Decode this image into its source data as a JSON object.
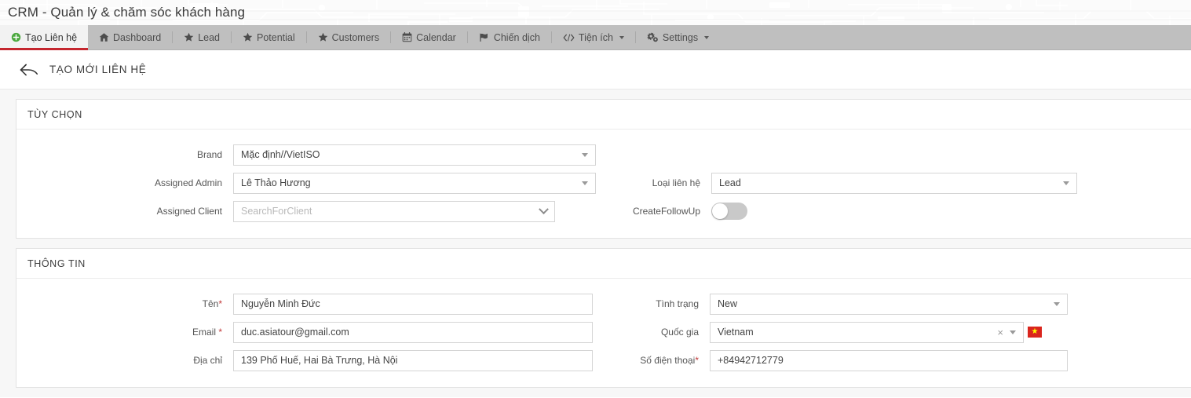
{
  "window": {
    "title": "CRM - Quản lý & chăm sóc khách hàng"
  },
  "tabs": [
    {
      "label": "Tạo Liên hệ",
      "icon": "plus-circle-icon",
      "active": true,
      "caret": false
    },
    {
      "label": "Dashboard",
      "icon": "home-icon",
      "active": false,
      "caret": false
    },
    {
      "label": "Lead",
      "icon": "star-icon",
      "active": false,
      "caret": false
    },
    {
      "label": "Potential",
      "icon": "star-icon",
      "active": false,
      "caret": false
    },
    {
      "label": "Customers",
      "icon": "star-icon",
      "active": false,
      "caret": false
    },
    {
      "label": "Calendar",
      "icon": "calendar-icon",
      "active": false,
      "caret": false
    },
    {
      "label": "Chiến dịch",
      "icon": "flag-icon",
      "active": false,
      "caret": false
    },
    {
      "label": "Tiện ích",
      "icon": "code-icon",
      "active": false,
      "caret": true
    },
    {
      "label": "Settings",
      "icon": "gears-icon",
      "active": false,
      "caret": true
    }
  ],
  "page_header": {
    "back_icon": "back-arrow-icon",
    "title": "TẠO MỚI LIÊN HỆ"
  },
  "sections": {
    "options": {
      "title": "TÙY CHỌN",
      "fields": {
        "brand": {
          "label": "Brand",
          "value": "Mặc định//VietISO"
        },
        "assigned_admin": {
          "label": "Assigned Admin",
          "value": "Lê Thảo Hương"
        },
        "assigned_client": {
          "label": "Assigned Client",
          "placeholder": "SearchForClient",
          "value": ""
        },
        "contact_type": {
          "label": "Loại liên hệ",
          "value": "Lead"
        },
        "create_followup": {
          "label": "CreateFollowUp",
          "state": "off"
        }
      }
    },
    "info": {
      "title": "THÔNG TIN",
      "fields": {
        "name": {
          "label": "Tên",
          "required": "*",
          "value": "Nguyễn Minh Đức"
        },
        "email": {
          "label": "Email ",
          "required": "*",
          "value": "duc.asiatour@gmail.com"
        },
        "address": {
          "label": "Địa chỉ",
          "required": "",
          "value": "139 Phố Huế, Hai Bà Trưng, Hà Nội"
        },
        "status": {
          "label": "Tình trạng",
          "required": "",
          "value": "New"
        },
        "country": {
          "label": "Quốc gia",
          "required": "",
          "value": "Vietnam",
          "flag": "vietnam-flag-icon",
          "clear": "×"
        },
        "phone": {
          "label": "Số điện thoại",
          "required": "*",
          "value": "+84942712779"
        }
      }
    }
  },
  "colors": {
    "accent_red": "#c4262e",
    "tabbar_gray": "#bfbfbf",
    "flag_red": "#da251d",
    "flag_star": "#ffff00",
    "required_star": "#c23b3b"
  }
}
